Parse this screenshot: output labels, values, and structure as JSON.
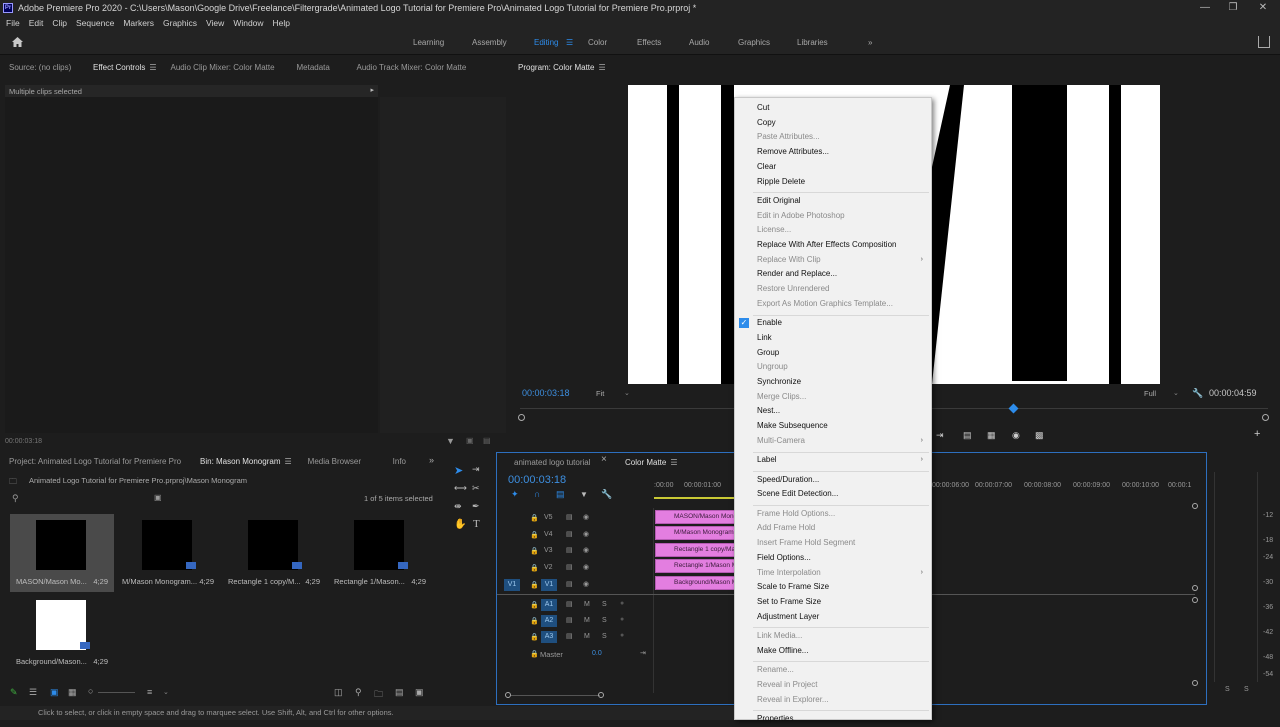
{
  "titlebar": {
    "title": "Adobe Premiere Pro 2020 - C:\\Users\\Mason\\Google Drive\\Freelance\\Filtergrade\\Animated Logo Tutorial for Premiere Pro\\Animated Logo Tutorial for Premiere Pro.prproj *"
  },
  "menu": [
    "File",
    "Edit",
    "Clip",
    "Sequence",
    "Markers",
    "Graphics",
    "View",
    "Window",
    "Help"
  ],
  "workspaces": [
    "Learning",
    "Assembly",
    "Editing",
    "Color",
    "Effects",
    "Audio",
    "Graphics",
    "Libraries"
  ],
  "active_workspace": "Editing",
  "source_panel": {
    "tabs": [
      "Source: (no clips)",
      "Effect Controls",
      "Audio Clip Mixer: Color Matte",
      "Metadata",
      "Audio Track Mixer: Color Matte"
    ],
    "message": "Multiple clips selected",
    "timecode": "00:00:03:18"
  },
  "program": {
    "title": "Program: Color Matte",
    "timecode": "00:00:03:18",
    "fit": "Fit",
    "quality": "Full",
    "duration": "00:00:04:59"
  },
  "project_panel": {
    "tabs": [
      "Project: Animated Logo Tutorial for Premiere Pro",
      "Bin: Mason Monogram",
      "Media Browser",
      "Info"
    ],
    "path": "Animated Logo Tutorial for Premiere Pro.prproj\\Mason Monogram",
    "selection": "1 of 5 items selected",
    "items": [
      {
        "name": "MASON/Mason Mo...",
        "dur": "4;29"
      },
      {
        "name": "M/Mason Monogram...",
        "dur": "4;29"
      },
      {
        "name": "Rectangle 1 copy/M...",
        "dur": "4;29"
      },
      {
        "name": "Rectangle 1/Mason...",
        "dur": "4;29"
      },
      {
        "name": "Background/Mason...",
        "dur": "4;29"
      }
    ]
  },
  "timeline": {
    "tabs": [
      "animated logo tutorial",
      "Color Matte"
    ],
    "timecode": "00:00:03:18",
    "ruler": [
      ":00:00",
      "00:00:01:00",
      "00:00:06:00",
      "00:00:07:00",
      "00:00:08:00",
      "00:00:09:00",
      "00:00:10:00",
      "00:00:1"
    ],
    "video_tracks": [
      "V5",
      "V4",
      "V3",
      "V2",
      "V1"
    ],
    "audio_tracks": [
      "A1",
      "A2",
      "A3"
    ],
    "master_label": "Master",
    "master_value": "0.0",
    "clips": [
      "MASON/Mason Monog",
      "M/Mason Monogram.p",
      "Rectangle 1 copy/Mas",
      "Rectangle 1/Mason M",
      "Background/Mason M"
    ],
    "meter_scale": [
      "-12",
      "-18",
      "-24",
      "-30",
      "-36",
      "-42",
      "-48",
      "-54"
    ],
    "meter_labels": [
      "S",
      "S"
    ]
  },
  "context_menu": [
    {
      "label": "Cut",
      "enabled": true
    },
    {
      "label": "Copy",
      "enabled": true
    },
    {
      "label": "Paste Attributes...",
      "enabled": false
    },
    {
      "label": "Remove Attributes...",
      "enabled": true
    },
    {
      "label": "Clear",
      "enabled": true
    },
    {
      "label": "Ripple Delete",
      "enabled": true
    },
    {
      "sep": true
    },
    {
      "label": "Edit Original",
      "enabled": true
    },
    {
      "label": "Edit in Adobe Photoshop",
      "enabled": false
    },
    {
      "label": "License...",
      "enabled": false
    },
    {
      "label": "Replace With After Effects Composition",
      "enabled": true
    },
    {
      "label": "Replace With Clip",
      "enabled": false,
      "submenu": true
    },
    {
      "label": "Render and Replace...",
      "enabled": true
    },
    {
      "label": "Restore Unrendered",
      "enabled": false
    },
    {
      "label": "Export As Motion Graphics Template...",
      "enabled": false
    },
    {
      "sep": true
    },
    {
      "label": "Enable",
      "enabled": true,
      "checked": true
    },
    {
      "label": "Link",
      "enabled": true
    },
    {
      "label": "Group",
      "enabled": true
    },
    {
      "label": "Ungroup",
      "enabled": false
    },
    {
      "label": "Synchronize",
      "enabled": true
    },
    {
      "label": "Merge Clips...",
      "enabled": false
    },
    {
      "label": "Nest...",
      "enabled": true
    },
    {
      "label": "Make Subsequence",
      "enabled": true
    },
    {
      "label": "Multi-Camera",
      "enabled": false,
      "submenu": true
    },
    {
      "sep": true
    },
    {
      "label": "Label",
      "enabled": true,
      "submenu": true
    },
    {
      "sep": true
    },
    {
      "label": "Speed/Duration...",
      "enabled": true
    },
    {
      "label": "Scene Edit Detection...",
      "enabled": true
    },
    {
      "sep": true
    },
    {
      "label": "Frame Hold Options...",
      "enabled": false
    },
    {
      "label": "Add Frame Hold",
      "enabled": false
    },
    {
      "label": "Insert Frame Hold Segment",
      "enabled": false
    },
    {
      "label": "Field Options...",
      "enabled": true
    },
    {
      "label": "Time Interpolation",
      "enabled": false,
      "submenu": true
    },
    {
      "label": "Scale to Frame Size",
      "enabled": true
    },
    {
      "label": "Set to Frame Size",
      "enabled": true
    },
    {
      "label": "Adjustment Layer",
      "enabled": true
    },
    {
      "sep": true
    },
    {
      "label": "Link Media...",
      "enabled": false
    },
    {
      "label": "Make Offline...",
      "enabled": true
    },
    {
      "sep": true
    },
    {
      "label": "Rename...",
      "enabled": false
    },
    {
      "label": "Reveal in Project",
      "enabled": false
    },
    {
      "label": "Reveal in Explorer...",
      "enabled": false
    },
    {
      "sep": true
    },
    {
      "label": "Properties",
      "enabled": true
    }
  ],
  "status": "Click to select, or click in empty space and drag to marquee select. Use Shift, Alt, and Ctrl for other options.",
  "colors": {
    "accent": "#2d8ceb",
    "clip": "#e37ee0",
    "panel": "#1d1d1d"
  }
}
